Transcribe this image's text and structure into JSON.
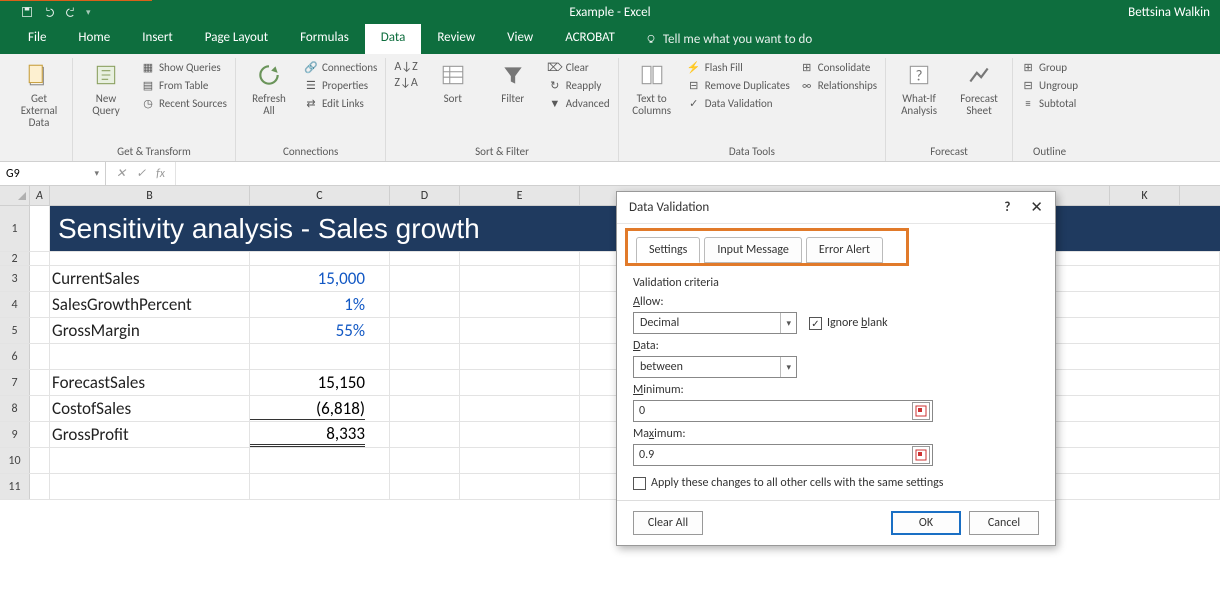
{
  "app": {
    "title": "Example - Excel",
    "user": "Bettsina Walkin"
  },
  "tabs": {
    "file": "File",
    "home": "Home",
    "insert": "Insert",
    "page_layout": "Page Layout",
    "formulas": "Formulas",
    "data": "Data",
    "review": "Review",
    "view": "View",
    "acrobat": "ACROBAT",
    "tellme": "Tell me what you want to do"
  },
  "ribbon": {
    "get_external_data": "Get External\nData",
    "new_query": "New\nQuery",
    "show_queries": "Show Queries",
    "from_table": "From Table",
    "recent_sources": "Recent Sources",
    "get_transform": "Get & Transform",
    "refresh_all": "Refresh\nAll",
    "connections": "Connections",
    "properties": "Properties",
    "edit_links": "Edit Links",
    "conn_group": "Connections",
    "sort": "Sort",
    "filter": "Filter",
    "clear": "Clear",
    "reapply": "Reapply",
    "advanced": "Advanced",
    "sort_filter": "Sort & Filter",
    "text_to_columns": "Text to\nColumns",
    "flash_fill": "Flash Fill",
    "remove_dup": "Remove Duplicates",
    "data_validation": "Data Validation",
    "consolidate": "Consolidate",
    "relationships": "Relationships",
    "data_tools": "Data Tools",
    "what_if": "What-If\nAnalysis",
    "forecast_sheet": "Forecast\nSheet",
    "forecast": "Forecast",
    "group": "Group",
    "ungroup": "Ungroup",
    "subtotal": "Subtotal",
    "outline": "Outline"
  },
  "formula_bar": {
    "name": "G9",
    "fx": "fx",
    "value": ""
  },
  "cols": {
    "A": "A",
    "B": "B",
    "C": "C",
    "D": "D",
    "E": "E",
    "K": "K"
  },
  "sheet": {
    "title": "Sensitivity analysis - Sales growth",
    "r3_label": "CurrentSales",
    "r3_val": "15,000",
    "r4_label": "SalesGrowthPercent",
    "r4_val": "1%",
    "r5_label": "GrossMargin",
    "r5_val": "55%",
    "r7_label": "ForecastSales",
    "r7_val": "15,150",
    "r8_label": "CostofSales",
    "r8_val": "(6,818)",
    "r9_label": "GrossProfit",
    "r9_val": "8,333"
  },
  "rows": {
    "1": "1",
    "2": "2",
    "3": "3",
    "4": "4",
    "5": "5",
    "6": "6",
    "7": "7",
    "8": "8",
    "9": "9",
    "10": "10",
    "11": "11"
  },
  "dialog": {
    "title": "Data Validation",
    "tab_settings": "Settings",
    "tab_input": "Input Message",
    "tab_error": "Error Alert",
    "criteria": "Validation criteria",
    "allow_lbl": "Allow:",
    "allow_val": "Decimal",
    "ignore_blank": "Ignore blank",
    "data_lbl": "Data:",
    "data_val": "between",
    "min_lbl": "Minimum:",
    "min_val": "0",
    "max_lbl": "Maximum:",
    "max_val": "0.9",
    "apply_all": "Apply these changes to all other cells with the same settings",
    "clear_all": "Clear All",
    "ok": "OK",
    "cancel": "Cancel"
  }
}
